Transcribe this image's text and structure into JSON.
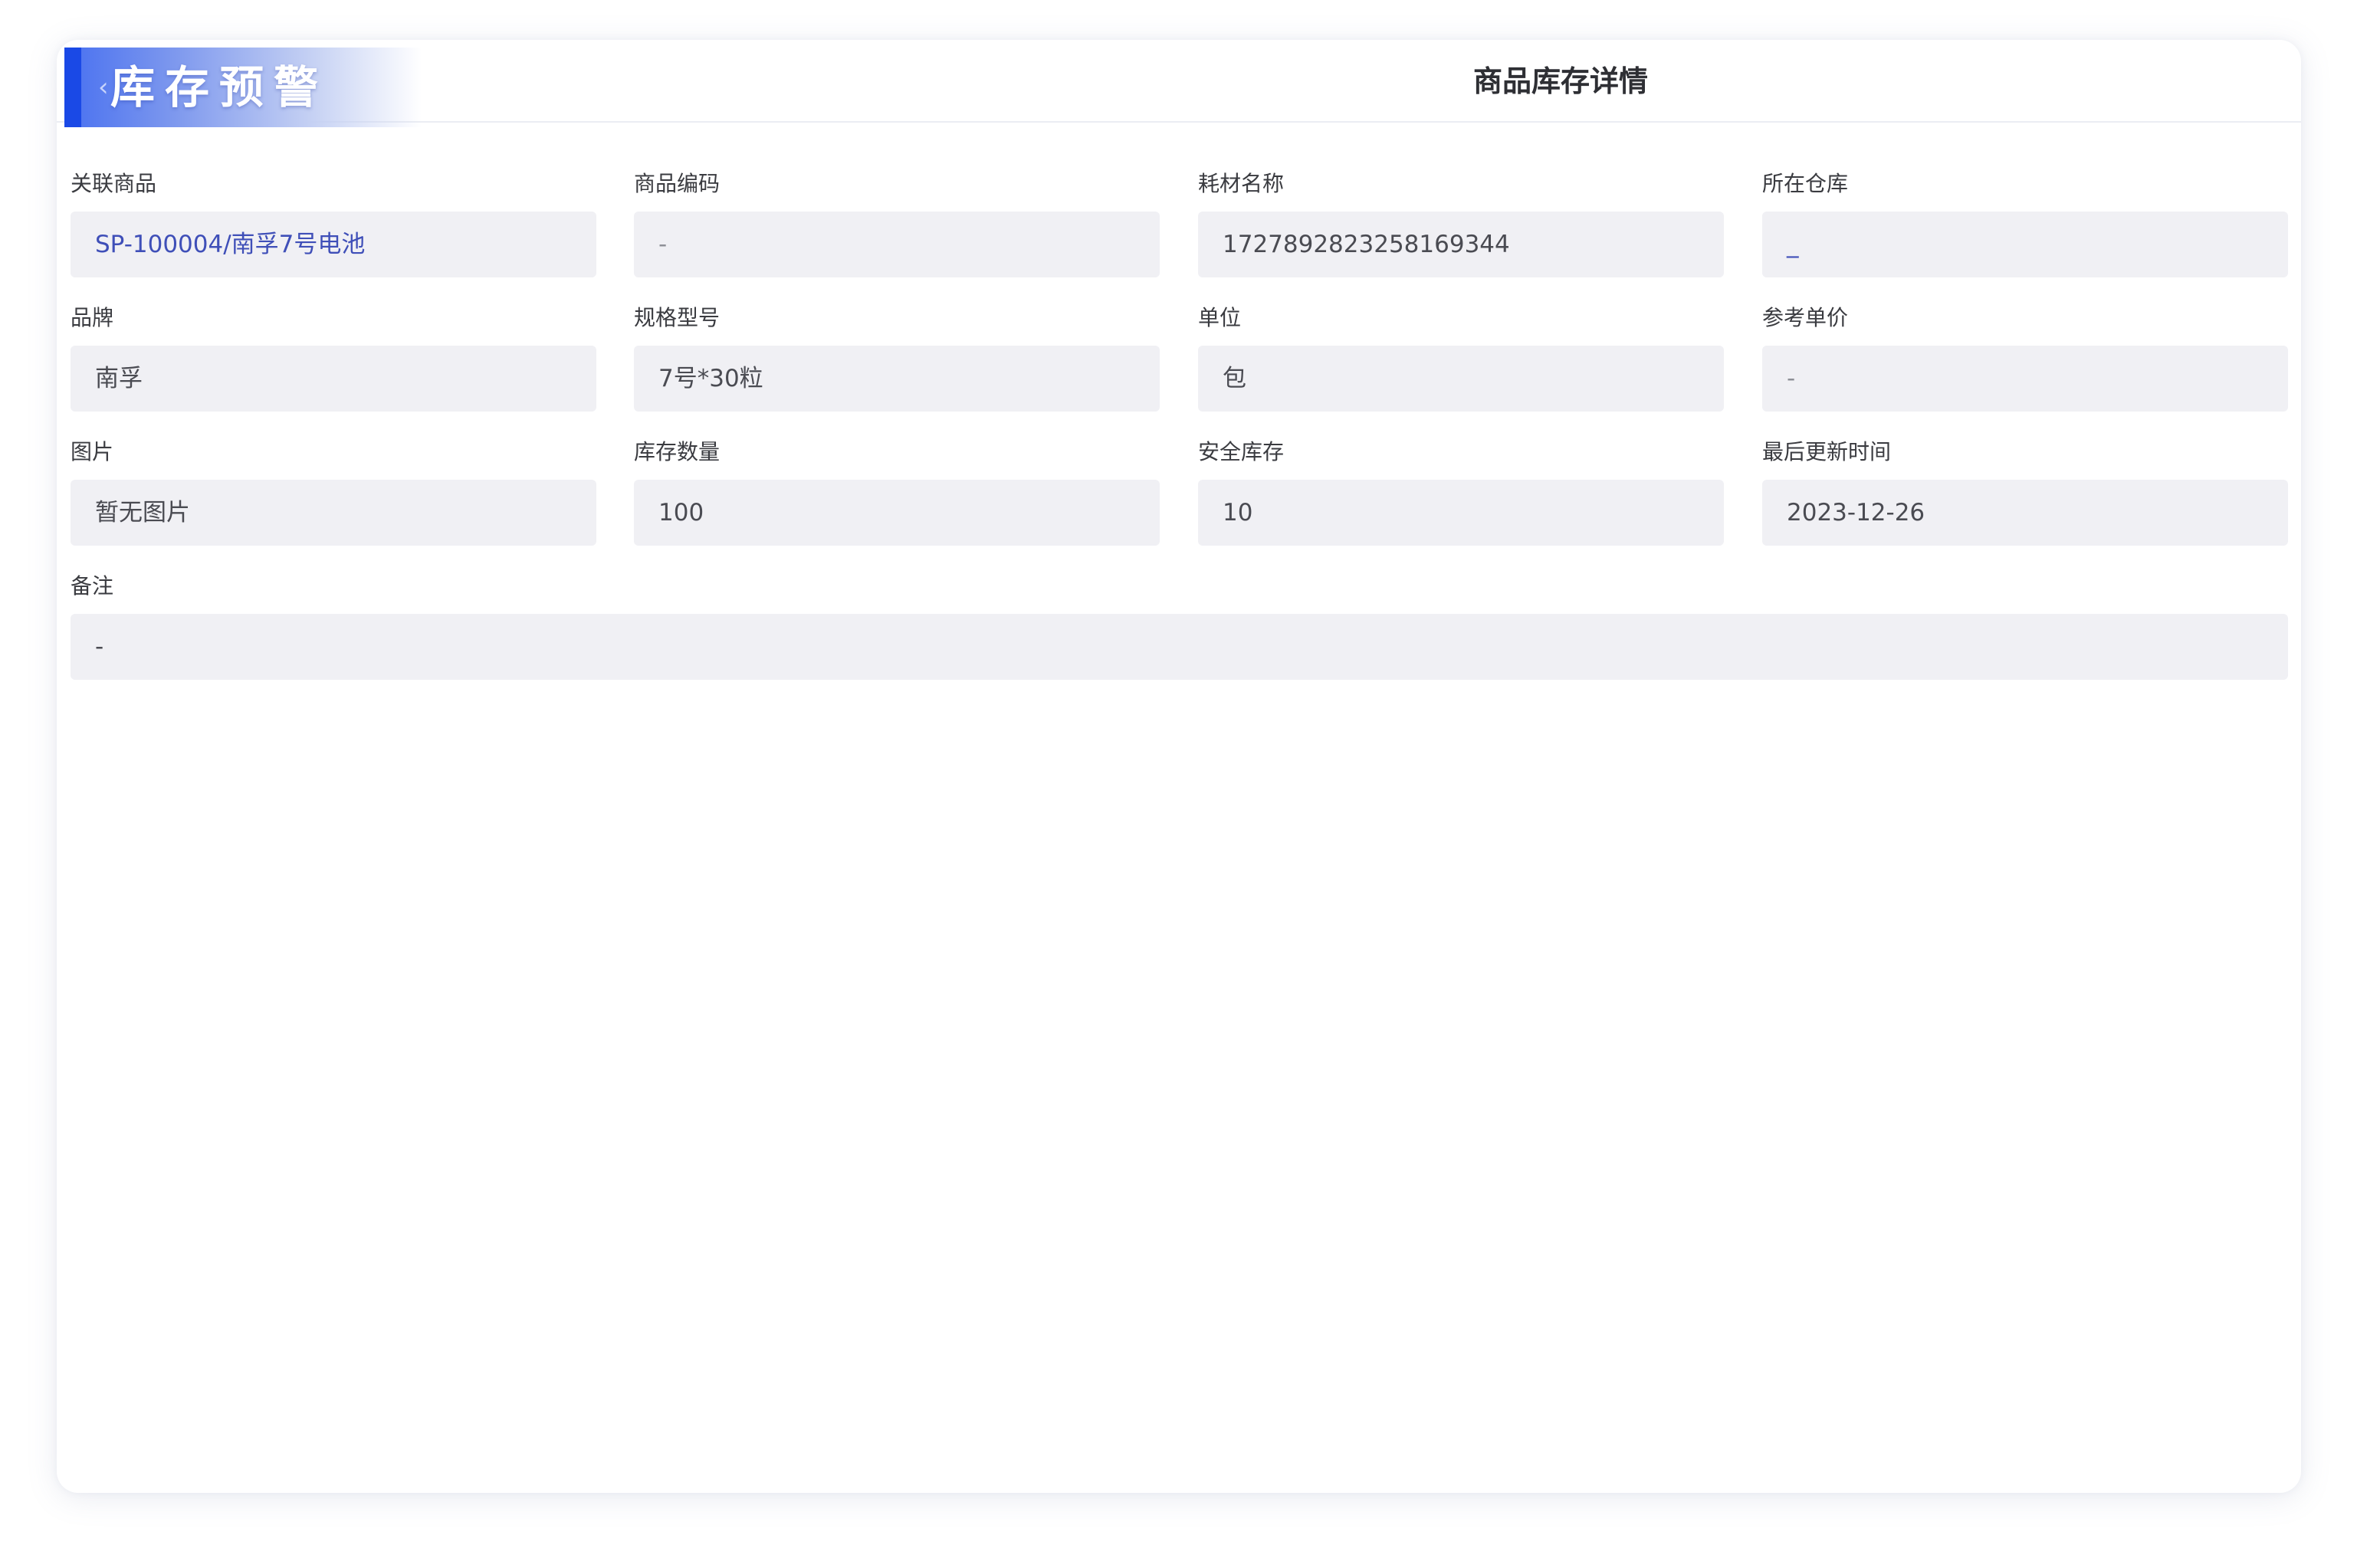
{
  "header": {
    "badge_title": "库存预警",
    "page_title": "商品库存详情"
  },
  "fields": [
    {
      "label": "关联商品",
      "value": "SP-100004/南孚7号电池"
    },
    {
      "label": "商品编码",
      "value": "-"
    },
    {
      "label": "耗材名称",
      "value": "1727892823258169344"
    },
    {
      "label": "所在仓库",
      "value": "_"
    },
    {
      "label": "品牌",
      "value": "南孚"
    },
    {
      "label": "规格型号",
      "value": "7号*30粒"
    },
    {
      "label": "单位",
      "value": "包"
    },
    {
      "label": "参考单价",
      "value": "-"
    },
    {
      "label": "图片",
      "value": "暂无图片"
    },
    {
      "label": "库存数量",
      "value": "100"
    },
    {
      "label": "安全库存",
      "value": "10"
    },
    {
      "label": "最后更新时间",
      "value": "2023-12-26"
    },
    {
      "label": "备注",
      "value": "-"
    }
  ],
  "colors": {
    "accent": "#1a49e6",
    "link_text": "#3f4fb8",
    "field_bg": "#f0f0f4"
  }
}
